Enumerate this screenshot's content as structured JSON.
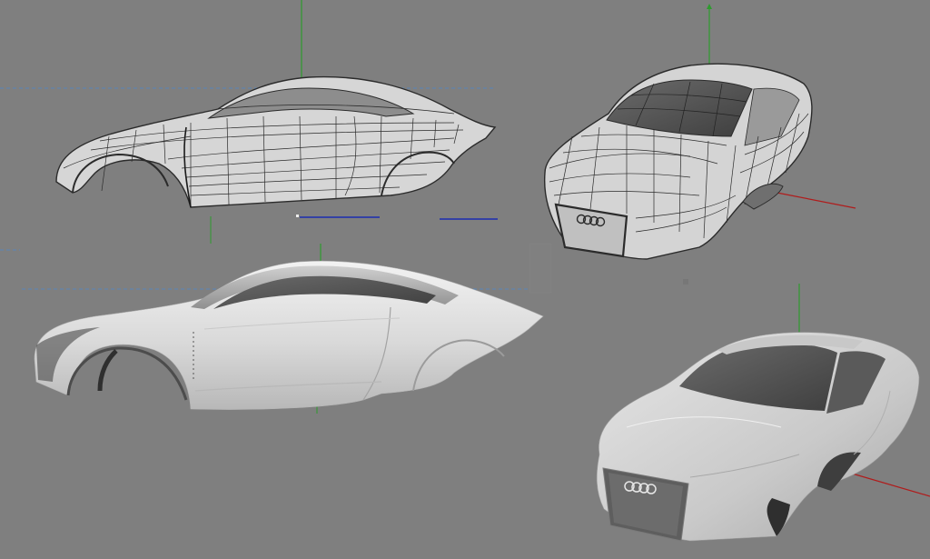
{
  "app": {
    "title": ""
  },
  "scene": {
    "background": "#7f7f7f",
    "axis_colors": {
      "y_axis": "#2e9b2e",
      "x_axis": "#b01c1c",
      "z_axis": "#1c2db0",
      "guide": "#5a86b8"
    },
    "car_model_wire": {
      "fill": "#d8d8d8",
      "wire": "#2b2b2b"
    },
    "car_model_shaded": {
      "fill": "#e2e2e2",
      "shadow": "#9a9a9a"
    },
    "views": [
      {
        "id": "side-wire",
        "mode": "wireframe",
        "projection": "side"
      },
      {
        "id": "persp-wire",
        "mode": "wireframe",
        "projection": "perspective"
      },
      {
        "id": "side-shaded",
        "mode": "shaded",
        "projection": "side"
      },
      {
        "id": "persp-shaded",
        "mode": "shaded",
        "projection": "perspective"
      }
    ]
  }
}
